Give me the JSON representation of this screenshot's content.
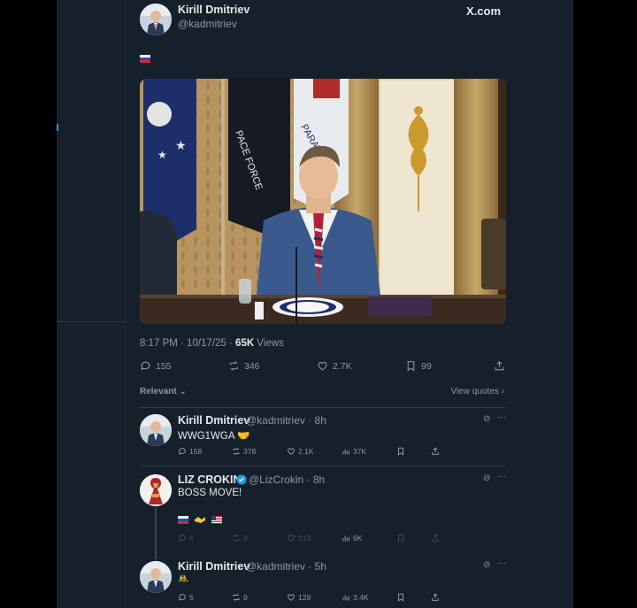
{
  "window": {
    "site": "X.com"
  },
  "tweet": {
    "author_name": "Kirill Dmitriev",
    "author_handle": "@kadmitriev",
    "text_flag": "🇷🇺",
    "time": "8:17 PM · 10/17/25 · ",
    "views_count": "65K",
    "views_label": " Views",
    "stats": {
      "replies": "155",
      "reposts": "346",
      "likes": "2.7K",
      "bookmarks": "99"
    }
  },
  "sort": {
    "relevant": "Relevant",
    "view_quotes": "View quotes"
  },
  "replies": [
    {
      "name": "Kirill Dmitriev",
      "meta": "@kadmitriev · 8h",
      "text": "WWG1WGA 🤝",
      "stats": {
        "replies": "158",
        "reposts": "378",
        "likes": "2.1K",
        "views": "37K"
      }
    },
    {
      "name": "LIZ CROKIN",
      "verified": true,
      "meta": "@LizCrokin · 8h",
      "text": "BOSS MOVE!",
      "quote_emoji": "🇷🇺 🤝 🇺🇸",
      "stats": {
        "replies": "6",
        "reposts": "9",
        "likes": "213",
        "views": "6K"
      }
    },
    {
      "name": "Kirill Dmitriev",
      "meta": "@kadmitriev · 5h",
      "text": "🤼",
      "stats": {
        "replies": "5",
        "reposts": "9",
        "likes": "129",
        "views": "3.4K"
      }
    }
  ],
  "colors": {
    "background": "#15202b",
    "accent": "#1d9bf0",
    "muted": "#8b98a5",
    "text": "#e7e9ea"
  }
}
